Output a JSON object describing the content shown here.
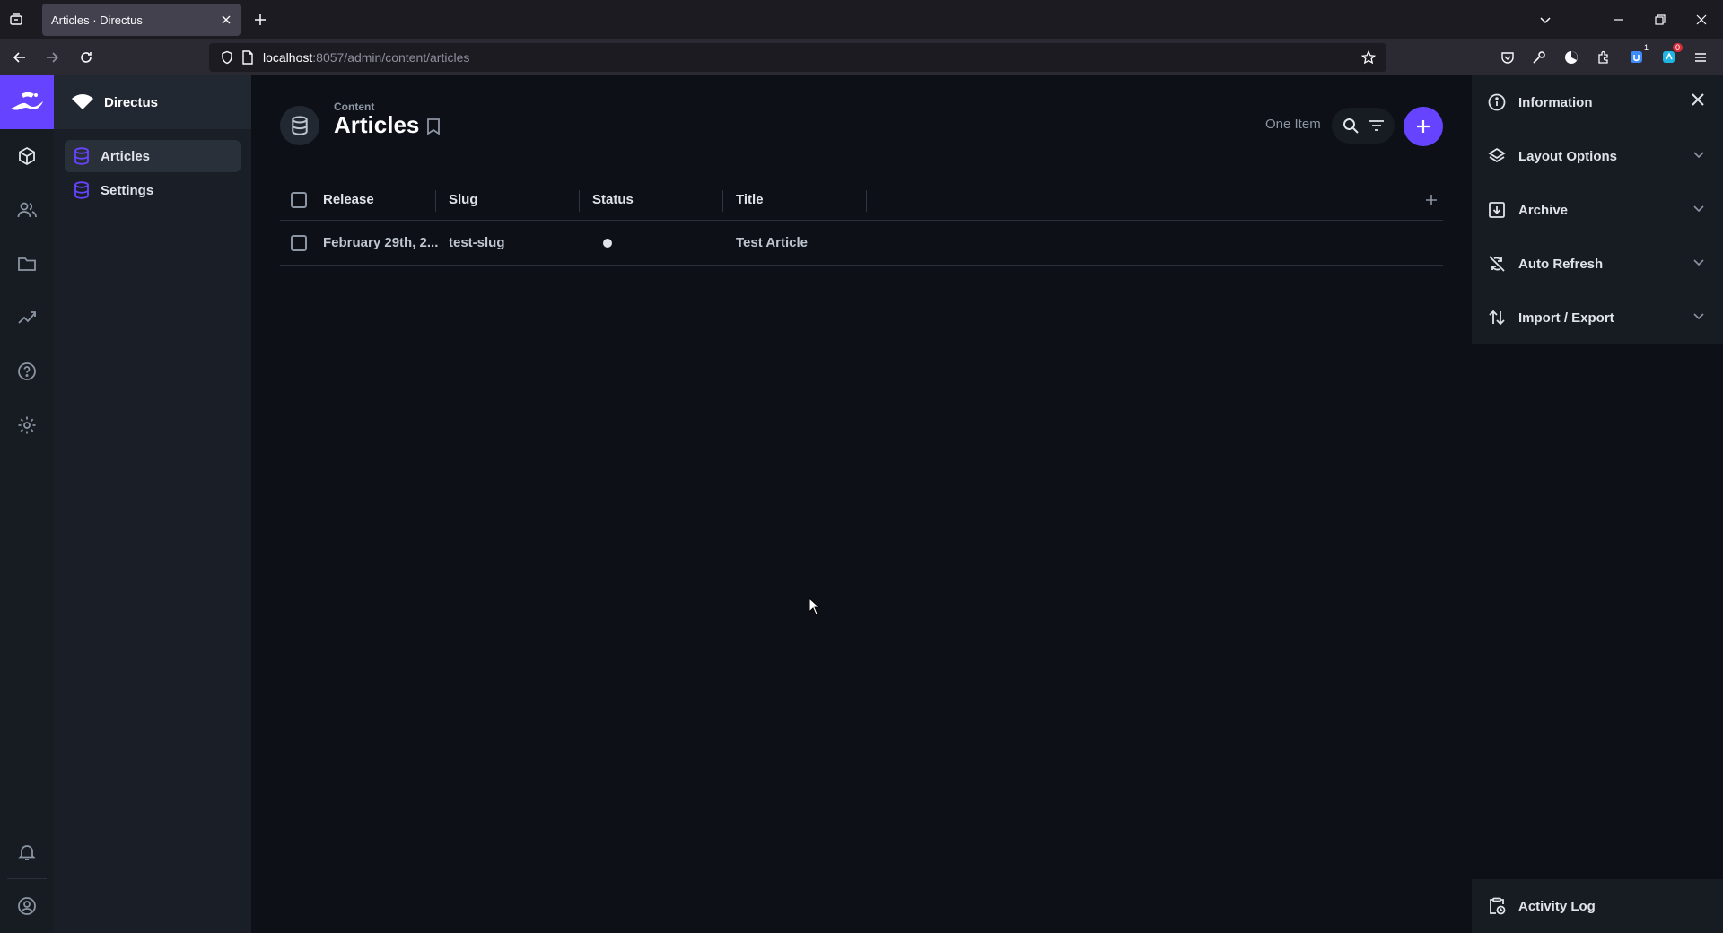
{
  "browser": {
    "tab_title": "Articles · Directus",
    "url_host": "localhost",
    "url_path": ":8057/admin/content/articles",
    "ext_badges": [
      "1",
      "0"
    ]
  },
  "nav": {
    "project_name": "Directus",
    "items": [
      {
        "label": "Articles",
        "active": true
      },
      {
        "label": "Settings",
        "active": false
      }
    ]
  },
  "header": {
    "breadcrumb": "Content",
    "title": "Articles",
    "item_count": "One Item"
  },
  "table": {
    "columns": [
      "Release",
      "Slug",
      "Status",
      "Title"
    ],
    "rows": [
      {
        "release": "February 29th, 2...",
        "slug": "test-slug",
        "status": "●",
        "title": "Test Article"
      }
    ]
  },
  "sidebar": {
    "sections": [
      {
        "label": "Information",
        "icon": "info-icon"
      },
      {
        "label": "Layout Options",
        "icon": "layers-icon"
      },
      {
        "label": "Archive",
        "icon": "archive-icon"
      },
      {
        "label": "Auto Refresh",
        "icon": "sync-disabled-icon"
      },
      {
        "label": "Import / Export",
        "icon": "import-export-icon"
      }
    ],
    "footer_label": "Activity Log"
  },
  "colors": {
    "accent": "#6644ff",
    "background": "#0d1117",
    "panel": "#171b22"
  }
}
